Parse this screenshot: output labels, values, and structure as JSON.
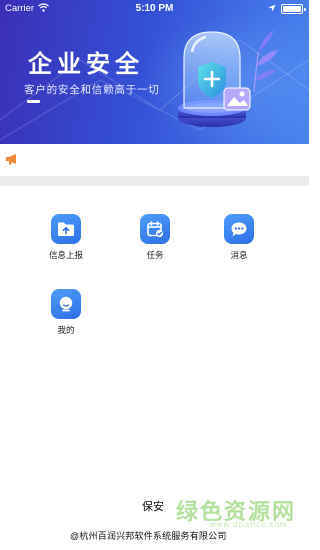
{
  "status_bar": {
    "carrier": "Carrier",
    "time": "5:10 PM"
  },
  "hero": {
    "title": "企业安全",
    "subtitle": "客户的安全和信赖高于一切"
  },
  "grid": [
    {
      "label": "信息上报",
      "icon": "upload-folder-icon"
    },
    {
      "label": "任务",
      "icon": "calendar-check-icon"
    },
    {
      "label": "消息",
      "icon": "chat-bubble-icon"
    },
    {
      "label": "我的",
      "icon": "profile-avatar-icon"
    }
  ],
  "footer": {
    "name": "保安",
    "company": "@杭州百润兴邦软件系统服务有限公司"
  },
  "watermark": {
    "text": "绿色资源网",
    "url": "www.downcc.com"
  },
  "colors": {
    "hero_start": "#3a2fb6",
    "hero_end": "#4a86f0",
    "icon_blue": "#2f6fe8",
    "notice_orange": "#f08a3a"
  }
}
